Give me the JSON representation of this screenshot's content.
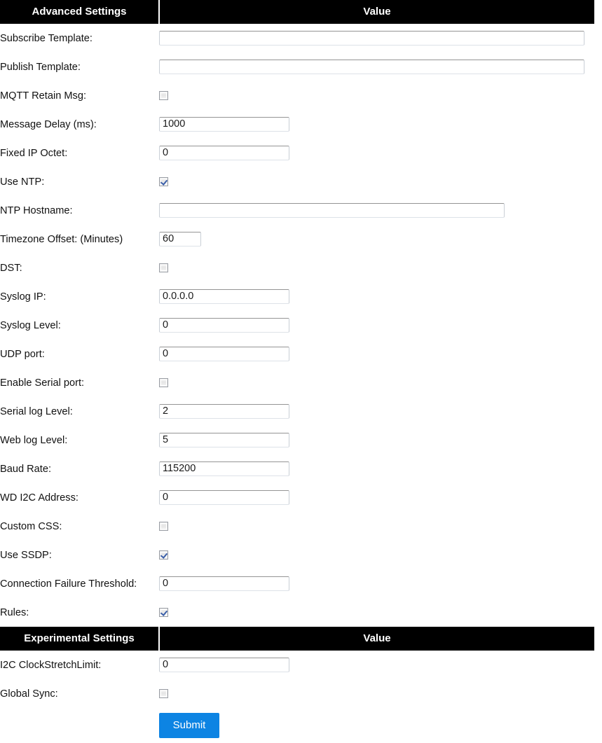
{
  "sections": [
    {
      "header": {
        "name": "Advanced Settings",
        "value": "Value"
      },
      "rows": [
        {
          "label": "Subscribe Template:",
          "type": "text",
          "value": "",
          "width": "wide"
        },
        {
          "label": "Publish Template:",
          "type": "text",
          "value": "",
          "width": "wide"
        },
        {
          "label": "MQTT Retain Msg:",
          "type": "checkbox",
          "checked": false
        },
        {
          "label": "Message Delay (ms):",
          "type": "text",
          "value": "1000",
          "width": "std"
        },
        {
          "label": "Fixed IP Octet:",
          "type": "text",
          "value": "0",
          "width": "std"
        },
        {
          "label": "Use NTP:",
          "type": "checkbox",
          "checked": true
        },
        {
          "label": "NTP Hostname:",
          "type": "text",
          "value": "",
          "width": "mid"
        },
        {
          "label": "Timezone Offset: (Minutes)",
          "type": "text",
          "value": "60",
          "width": "small"
        },
        {
          "label": "DST:",
          "type": "checkbox",
          "checked": false
        },
        {
          "label": "Syslog IP:",
          "type": "text",
          "value": "0.0.0.0",
          "width": "std"
        },
        {
          "label": "Syslog Level:",
          "type": "text",
          "value": "0",
          "width": "std"
        },
        {
          "label": "UDP port:",
          "type": "text",
          "value": "0",
          "width": "std"
        },
        {
          "label": "Enable Serial port:",
          "type": "checkbox",
          "checked": false
        },
        {
          "label": "Serial log Level:",
          "type": "text",
          "value": "2",
          "width": "std"
        },
        {
          "label": "Web log Level:",
          "type": "text",
          "value": "5",
          "width": "std"
        },
        {
          "label": "Baud Rate:",
          "type": "text",
          "value": "115200",
          "width": "std"
        },
        {
          "label": "WD I2C Address:",
          "type": "text",
          "value": "0",
          "width": "std"
        },
        {
          "label": "Custom CSS:",
          "type": "checkbox",
          "checked": false
        },
        {
          "label": "Use SSDP:",
          "type": "checkbox",
          "checked": true
        },
        {
          "label": "Connection Failure Threshold:",
          "type": "text",
          "value": "0",
          "width": "std"
        },
        {
          "label": "Rules:",
          "type": "checkbox",
          "checked": true
        }
      ]
    },
    {
      "header": {
        "name": "Experimental Settings",
        "value": "Value"
      },
      "rows": [
        {
          "label": "I2C ClockStretchLimit:",
          "type": "text",
          "value": "0",
          "width": "std"
        },
        {
          "label": "Global Sync:",
          "type": "checkbox",
          "checked": false
        }
      ]
    }
  ],
  "submit": {
    "label": "Submit"
  },
  "colors": {
    "header_bg": "#000000",
    "header_text": "#ffffff",
    "submit_bg": "#0d84e3",
    "submit_text": "#ffffff",
    "page_bg": "#ffffff",
    "input_border": "#c9cfd6"
  }
}
